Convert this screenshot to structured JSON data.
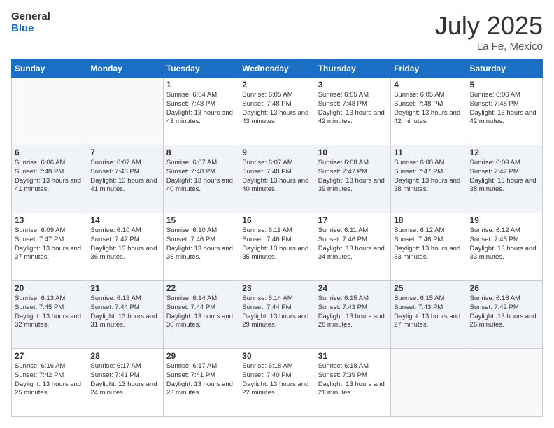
{
  "header": {
    "logo_line1": "General",
    "logo_line2": "Blue",
    "month_title": "July 2025",
    "location": "La Fe, Mexico"
  },
  "weekdays": [
    "Sunday",
    "Monday",
    "Tuesday",
    "Wednesday",
    "Thursday",
    "Friday",
    "Saturday"
  ],
  "rows": [
    [
      {
        "day": "",
        "info": ""
      },
      {
        "day": "",
        "info": ""
      },
      {
        "day": "1",
        "info": "Sunrise: 6:04 AM\nSunset: 7:48 PM\nDaylight: 13 hours and 43 minutes."
      },
      {
        "day": "2",
        "info": "Sunrise: 6:05 AM\nSunset: 7:48 PM\nDaylight: 13 hours and 43 minutes."
      },
      {
        "day": "3",
        "info": "Sunrise: 6:05 AM\nSunset: 7:48 PM\nDaylight: 13 hours and 42 minutes."
      },
      {
        "day": "4",
        "info": "Sunrise: 6:05 AM\nSunset: 7:48 PM\nDaylight: 13 hours and 42 minutes."
      },
      {
        "day": "5",
        "info": "Sunrise: 6:06 AM\nSunset: 7:48 PM\nDaylight: 13 hours and 42 minutes."
      }
    ],
    [
      {
        "day": "6",
        "info": "Sunrise: 6:06 AM\nSunset: 7:48 PM\nDaylight: 13 hours and 41 minutes."
      },
      {
        "day": "7",
        "info": "Sunrise: 6:07 AM\nSunset: 7:48 PM\nDaylight: 13 hours and 41 minutes."
      },
      {
        "day": "8",
        "info": "Sunrise: 6:07 AM\nSunset: 7:48 PM\nDaylight: 13 hours and 40 minutes."
      },
      {
        "day": "9",
        "info": "Sunrise: 6:07 AM\nSunset: 7:48 PM\nDaylight: 13 hours and 40 minutes."
      },
      {
        "day": "10",
        "info": "Sunrise: 6:08 AM\nSunset: 7:47 PM\nDaylight: 13 hours and 39 minutes."
      },
      {
        "day": "11",
        "info": "Sunrise: 6:08 AM\nSunset: 7:47 PM\nDaylight: 13 hours and 38 minutes."
      },
      {
        "day": "12",
        "info": "Sunrise: 6:09 AM\nSunset: 7:47 PM\nDaylight: 13 hours and 38 minutes."
      }
    ],
    [
      {
        "day": "13",
        "info": "Sunrise: 6:09 AM\nSunset: 7:47 PM\nDaylight: 13 hours and 37 minutes."
      },
      {
        "day": "14",
        "info": "Sunrise: 6:10 AM\nSunset: 7:47 PM\nDaylight: 13 hours and 36 minutes."
      },
      {
        "day": "15",
        "info": "Sunrise: 6:10 AM\nSunset: 7:46 PM\nDaylight: 13 hours and 36 minutes."
      },
      {
        "day": "16",
        "info": "Sunrise: 6:11 AM\nSunset: 7:46 PM\nDaylight: 13 hours and 35 minutes."
      },
      {
        "day": "17",
        "info": "Sunrise: 6:11 AM\nSunset: 7:46 PM\nDaylight: 13 hours and 34 minutes."
      },
      {
        "day": "18",
        "info": "Sunrise: 6:12 AM\nSunset: 7:46 PM\nDaylight: 13 hours and 33 minutes."
      },
      {
        "day": "19",
        "info": "Sunrise: 6:12 AM\nSunset: 7:45 PM\nDaylight: 13 hours and 33 minutes."
      }
    ],
    [
      {
        "day": "20",
        "info": "Sunrise: 6:13 AM\nSunset: 7:45 PM\nDaylight: 13 hours and 32 minutes."
      },
      {
        "day": "21",
        "info": "Sunrise: 6:13 AM\nSunset: 7:44 PM\nDaylight: 13 hours and 31 minutes."
      },
      {
        "day": "22",
        "info": "Sunrise: 6:14 AM\nSunset: 7:44 PM\nDaylight: 13 hours and 30 minutes."
      },
      {
        "day": "23",
        "info": "Sunrise: 6:14 AM\nSunset: 7:44 PM\nDaylight: 13 hours and 29 minutes."
      },
      {
        "day": "24",
        "info": "Sunrise: 6:15 AM\nSunset: 7:43 PM\nDaylight: 13 hours and 28 minutes."
      },
      {
        "day": "25",
        "info": "Sunrise: 6:15 AM\nSunset: 7:43 PM\nDaylight: 13 hours and 27 minutes."
      },
      {
        "day": "26",
        "info": "Sunrise: 6:16 AM\nSunset: 7:42 PM\nDaylight: 13 hours and 26 minutes."
      }
    ],
    [
      {
        "day": "27",
        "info": "Sunrise: 6:16 AM\nSunset: 7:42 PM\nDaylight: 13 hours and 25 minutes."
      },
      {
        "day": "28",
        "info": "Sunrise: 6:17 AM\nSunset: 7:41 PM\nDaylight: 13 hours and 24 minutes."
      },
      {
        "day": "29",
        "info": "Sunrise: 6:17 AM\nSunset: 7:41 PM\nDaylight: 13 hours and 23 minutes."
      },
      {
        "day": "30",
        "info": "Sunrise: 6:18 AM\nSunset: 7:40 PM\nDaylight: 13 hours and 22 minutes."
      },
      {
        "day": "31",
        "info": "Sunrise: 6:18 AM\nSunset: 7:39 PM\nDaylight: 13 hours and 21 minutes."
      },
      {
        "day": "",
        "info": ""
      },
      {
        "day": "",
        "info": ""
      }
    ]
  ],
  "shaded_rows": [
    1,
    3
  ]
}
